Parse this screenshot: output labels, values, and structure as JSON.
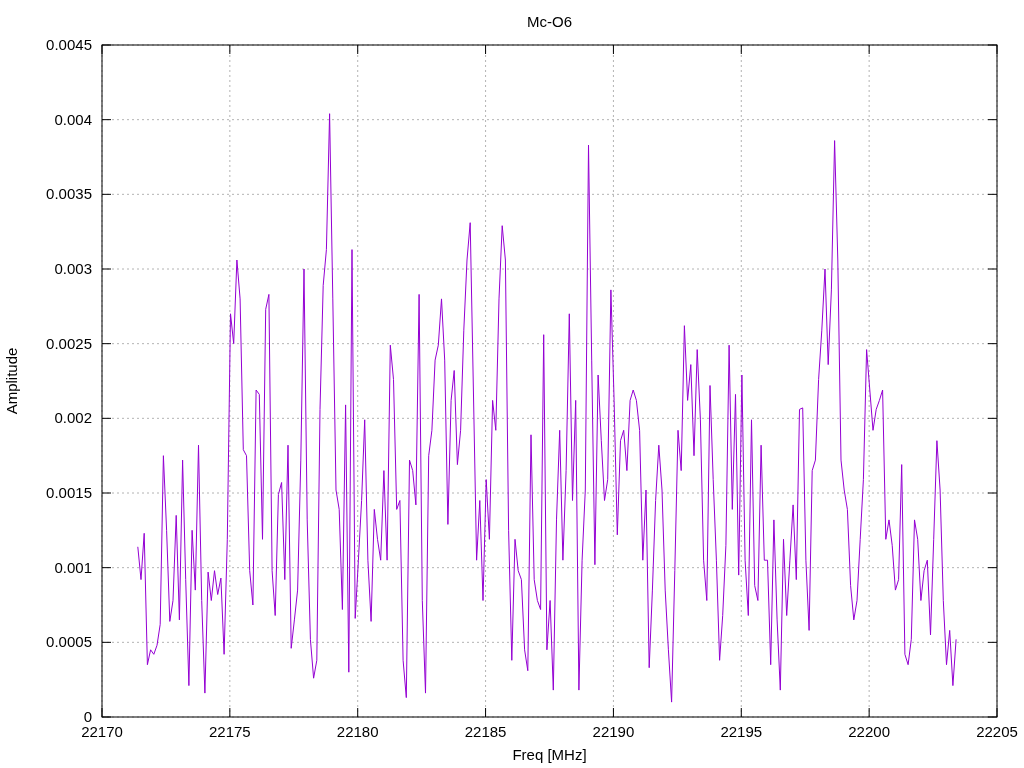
{
  "chart": {
    "chart_data": {
      "type": "line",
      "title": "Mc-O6",
      "xlabel": "Freq [MHz]",
      "ylabel": "Amplitude",
      "xlim": [
        22170,
        22205
      ],
      "ylim": [
        0,
        0.0045
      ],
      "grid": true,
      "xticks": [
        22170,
        22175,
        22180,
        22185,
        22190,
        22195,
        22200,
        22205
      ],
      "yticks": [
        0,
        0.0005,
        0.001,
        0.0015,
        0.002,
        0.0025,
        0.003,
        0.0035,
        0.004,
        0.0045
      ],
      "x": [
        22171.4,
        22171.525,
        22171.65,
        22171.775,
        22171.9,
        22172.025,
        22172.15,
        22172.275,
        22172.4,
        22172.525,
        22172.65,
        22172.775,
        22172.9,
        22173.025,
        22173.15,
        22173.275,
        22173.4,
        22173.525,
        22173.65,
        22173.775,
        22173.9,
        22174.025,
        22174.15,
        22174.275,
        22174.4,
        22174.525,
        22174.65,
        22174.775,
        22174.9,
        22175.025,
        22175.15,
        22175.275,
        22175.4,
        22175.525,
        22175.65,
        22175.775,
        22175.9,
        22176.025,
        22176.15,
        22176.275,
        22176.4,
        22176.525,
        22176.65,
        22176.775,
        22176.9,
        22177.025,
        22177.15,
        22177.275,
        22177.4,
        22177.525,
        22177.65,
        22177.775,
        22177.9,
        22178.025,
        22178.15,
        22178.275,
        22178.4,
        22178.525,
        22178.65,
        22178.775,
        22178.9,
        22179.025,
        22179.15,
        22179.275,
        22179.4,
        22179.525,
        22179.65,
        22179.775,
        22179.9,
        22180.025,
        22180.15,
        22180.275,
        22180.4,
        22180.525,
        22180.65,
        22180.775,
        22180.9,
        22181.025,
        22181.15,
        22181.275,
        22181.4,
        22181.525,
        22181.65,
        22181.775,
        22181.9,
        22182.025,
        22182.15,
        22182.275,
        22182.4,
        22182.525,
        22182.65,
        22182.775,
        22182.9,
        22183.025,
        22183.15,
        22183.275,
        22183.4,
        22183.525,
        22183.65,
        22183.775,
        22183.9,
        22184.025,
        22184.15,
        22184.275,
        22184.4,
        22184.525,
        22184.65,
        22184.775,
        22184.9,
        22185.025,
        22185.15,
        22185.275,
        22185.4,
        22185.525,
        22185.65,
        22185.775,
        22185.9,
        22186.025,
        22186.15,
        22186.275,
        22186.4,
        22186.525,
        22186.65,
        22186.775,
        22186.9,
        22187.025,
        22187.15,
        22187.275,
        22187.4,
        22187.525,
        22187.65,
        22187.775,
        22187.9,
        22188.025,
        22188.15,
        22188.275,
        22188.4,
        22188.525,
        22188.65,
        22188.775,
        22188.9,
        22189.025,
        22189.15,
        22189.275,
        22189.4,
        22189.525,
        22189.65,
        22189.775,
        22189.9,
        22190.025,
        22190.15,
        22190.275,
        22190.4,
        22190.525,
        22190.65,
        22190.775,
        22190.9,
        22191.025,
        22191.15,
        22191.275,
        22191.4,
        22191.525,
        22191.65,
        22191.775,
        22191.9,
        22192.025,
        22192.15,
        22192.275,
        22192.4,
        22192.525,
        22192.65,
        22192.775,
        22192.9,
        22193.025,
        22193.15,
        22193.275,
        22193.4,
        22193.525,
        22193.65,
        22193.775,
        22193.9,
        22194.025,
        22194.15,
        22194.275,
        22194.4,
        22194.525,
        22194.65,
        22194.775,
        22194.9,
        22195.025,
        22195.15,
        22195.275,
        22195.4,
        22195.525,
        22195.65,
        22195.775,
        22195.9,
        22196.025,
        22196.15,
        22196.275,
        22196.4,
        22196.525,
        22196.65,
        22196.775,
        22196.9,
        22197.025,
        22197.15,
        22197.275,
        22197.4,
        22197.525,
        22197.65,
        22197.775,
        22197.9,
        22198.025,
        22198.15,
        22198.275,
        22198.4,
        22198.525,
        22198.65,
        22198.775,
        22198.9,
        22199.025,
        22199.15,
        22199.275,
        22199.4,
        22199.525,
        22199.65,
        22199.775,
        22199.9,
        22200.025,
        22200.15,
        22200.275,
        22200.4,
        22200.525,
        22200.65,
        22200.775,
        22200.9,
        22201.025,
        22201.15,
        22201.275,
        22201.4,
        22201.525,
        22201.65,
        22201.775,
        22201.9,
        22202.025,
        22202.15,
        22202.275,
        22202.4,
        22202.525,
        22202.65,
        22202.775,
        22202.9,
        22203.025,
        22203.15,
        22203.275,
        22203.4
      ],
      "series": [
        {
          "color": "#9400d3",
          "values": [
            0.00114,
            0.00092,
            0.00123,
            0.00035,
            0.00045,
            0.00042,
            0.00048,
            0.00062,
            0.00175,
            0.00125,
            0.00064,
            0.00078,
            0.00135,
            0.00065,
            0.00172,
            0.00092,
            0.00021,
            0.00125,
            0.00085,
            0.00182,
            0.00078,
            0.00016,
            0.00097,
            0.00078,
            0.00098,
            0.00082,
            0.00093,
            0.00042,
            0.00119,
            0.0027,
            0.0025,
            0.00306,
            0.0028,
            0.00179,
            0.00175,
            0.00098,
            0.00075,
            0.00219,
            0.00216,
            0.00119,
            0.00273,
            0.00283,
            0.00098,
            0.00068,
            0.00149,
            0.00157,
            0.00092,
            0.00182,
            0.00046,
            0.00065,
            0.00085,
            0.00172,
            0.003,
            0.00132,
            0.00052,
            0.00026,
            0.00038,
            0.00206,
            0.00289,
            0.00313,
            0.00404,
            0.0028,
            0.00152,
            0.00139,
            0.00072,
            0.00209,
            0.0003,
            0.00313,
            0.00066,
            0.00105,
            0.00145,
            0.00199,
            0.00105,
            0.00064,
            0.00139,
            0.00119,
            0.00105,
            0.00165,
            0.00105,
            0.00249,
            0.00226,
            0.00139,
            0.00145,
            0.00038,
            0.00013,
            0.00172,
            0.00165,
            0.00142,
            0.00283,
            0.00078,
            0.00016,
            0.00175,
            0.00192,
            0.00239,
            0.00249,
            0.0028,
            0.00239,
            0.00129,
            0.00212,
            0.00232,
            0.00169,
            0.00192,
            0.00259,
            0.00306,
            0.00331,
            0.00219,
            0.00105,
            0.00145,
            0.00078,
            0.00159,
            0.00119,
            0.00212,
            0.00192,
            0.0028,
            0.00329,
            0.00306,
            0.00125,
            0.00038,
            0.00119,
            0.00098,
            0.00092,
            0.00045,
            0.00031,
            0.00189,
            0.00092,
            0.00078,
            0.00072,
            0.00256,
            0.00045,
            0.00078,
            0.00018,
            0.00132,
            0.00192,
            0.00105,
            0.00165,
            0.0027,
            0.00145,
            0.00212,
            0.00018,
            0.00105,
            0.00152,
            0.00383,
            0.00239,
            0.00102,
            0.00229,
            0.00185,
            0.00145,
            0.00159,
            0.00286,
            0.00212,
            0.00122,
            0.00185,
            0.00192,
            0.00165,
            0.00212,
            0.00219,
            0.00212,
            0.00192,
            0.00105,
            0.00152,
            0.00033,
            0.00085,
            0.00145,
            0.00182,
            0.00152,
            0.00085,
            0.00045,
            0.0001,
            0.00098,
            0.00192,
            0.00165,
            0.00262,
            0.00212,
            0.00236,
            0.00175,
            0.00246,
            0.00199,
            0.00105,
            0.00078,
            0.00222,
            0.00159,
            0.00105,
            0.00038,
            0.00068,
            0.00115,
            0.00249,
            0.00139,
            0.00216,
            0.00095,
            0.00229,
            0.00105,
            0.00068,
            0.00199,
            0.00088,
            0.00078,
            0.00182,
            0.00105,
            0.00105,
            0.00035,
            0.00132,
            0.00065,
            0.00018,
            0.00119,
            0.00068,
            0.00105,
            0.00142,
            0.00092,
            0.00206,
            0.00207,
            0.00105,
            0.00058,
            0.00165,
            0.00172,
            0.00226,
            0.00259,
            0.003,
            0.00236,
            0.00286,
            0.00386,
            0.00306,
            0.00172,
            0.00152,
            0.00139,
            0.00088,
            0.00065,
            0.00078,
            0.00119,
            0.00159,
            0.00246,
            0.00219,
            0.00192,
            0.00206,
            0.00212,
            0.00219,
            0.00119,
            0.00132,
            0.00115,
            0.00085,
            0.00092,
            0.00169,
            0.00042,
            0.00035,
            0.00052,
            0.00132,
            0.00119,
            0.00078,
            0.00098,
            0.00105,
            0.00055,
            0.00119,
            0.00185,
            0.00152,
            0.00078,
            0.00035,
            0.00058,
            0.00021,
            0.00052
          ]
        }
      ]
    }
  }
}
